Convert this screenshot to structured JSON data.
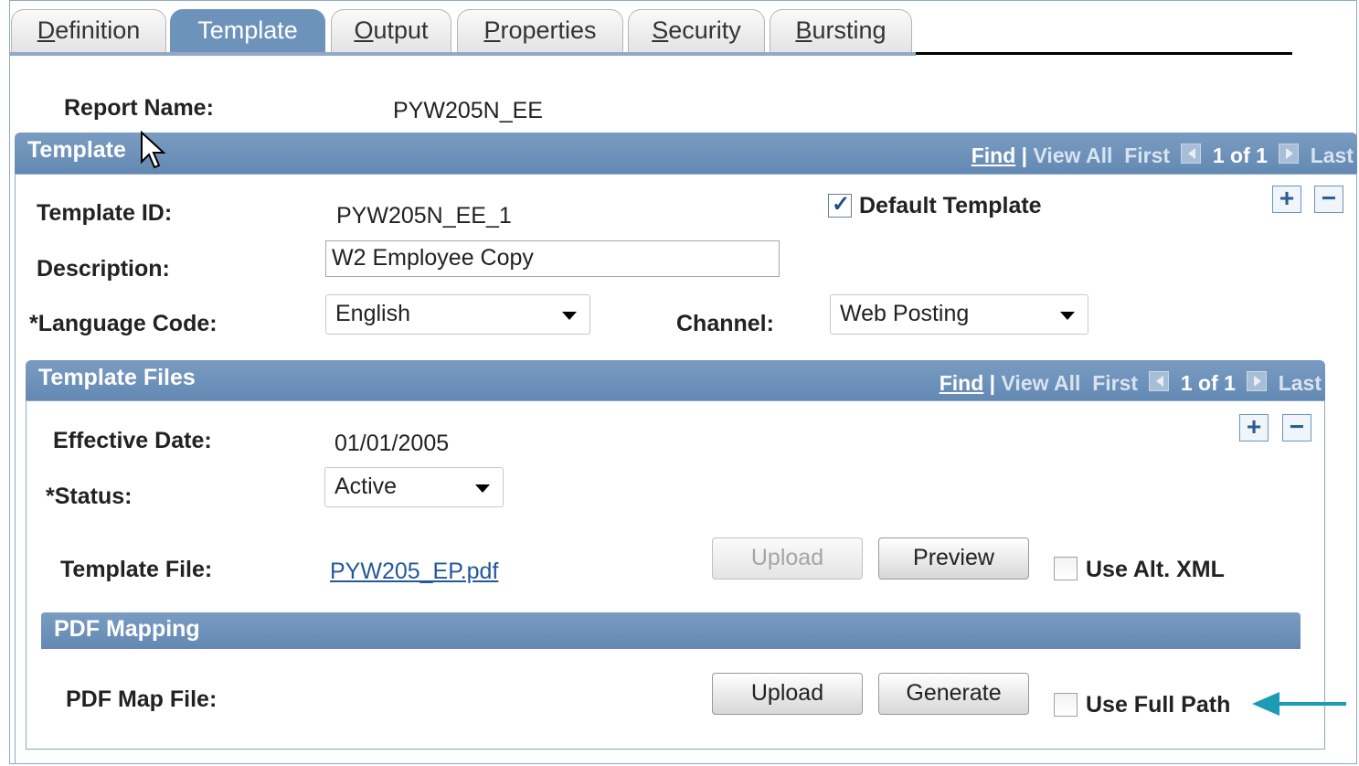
{
  "tabs": [
    {
      "prefix": "",
      "accel": "D",
      "rest": "efinition"
    },
    {
      "prefix": "Template",
      "accel": "",
      "rest": ""
    },
    {
      "prefix": "",
      "accel": "O",
      "rest": "utput"
    },
    {
      "prefix": "",
      "accel": "P",
      "rest": "roperties"
    },
    {
      "prefix": "",
      "accel": "S",
      "rest": "ecurity"
    },
    {
      "prefix": "",
      "accel": "B",
      "rest": "ursting"
    }
  ],
  "active_tab": "Template",
  "report": {
    "label": "Report Name:",
    "value": "PYW205N_EE"
  },
  "template_section": {
    "title": "Template",
    "nav": {
      "find": "Find",
      "sep": "|",
      "view_all": "View All",
      "first": "First",
      "count": "1 of 1",
      "last": "Last"
    },
    "template_id_label": "Template ID:",
    "template_id_value": "PYW205N_EE_1",
    "default_template_label": "Default Template",
    "default_template_checked": true,
    "description_label": "Description:",
    "description_value": "W2 Employee Copy",
    "language_label": "*Language Code:",
    "language_value": "English",
    "channel_label": "Channel:",
    "channel_value": "Web Posting",
    "add_icon": "plus-icon",
    "remove_icon": "minus-icon"
  },
  "files_section": {
    "title": "Template Files",
    "nav": {
      "find": "Find",
      "sep": "|",
      "view_all": "View All",
      "first": "First",
      "count": "1 of 1",
      "last": "Last"
    },
    "effective_date_label": "Effective Date:",
    "effective_date_value": "01/01/2005",
    "status_label": "*Status:",
    "status_value": "Active",
    "template_file_label": "Template File:",
    "template_file_value": "PYW205_EP.pdf",
    "upload_label": "Upload",
    "preview_label": "Preview",
    "alt_xml_label": "Use Alt. XML",
    "alt_xml_checked": false
  },
  "pdf_section": {
    "title": "PDF Mapping",
    "map_file_label": "PDF Map File:",
    "upload_label": "Upload",
    "generate_label": "Generate",
    "full_path_label": "Use Full Path",
    "full_path_checked": false
  },
  "colors": {
    "header": "#6d93bb",
    "link": "#23589d",
    "arrow": "#1c9bb5"
  }
}
